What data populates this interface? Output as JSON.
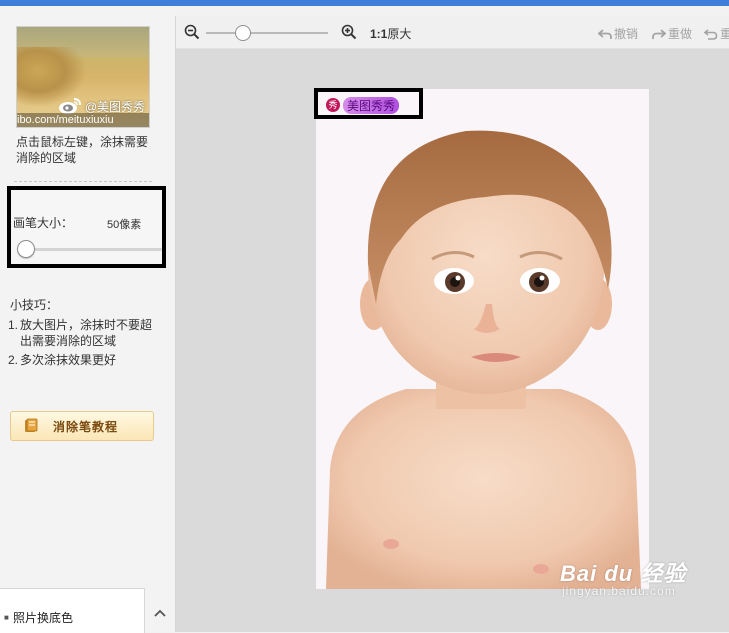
{
  "left_panel": {
    "thumbnail": {
      "watermark": "@美图秀秀",
      "url": "ibo.com/meituxiuxiu"
    },
    "hint": "点击鼠标左键，涂抹需要消除的区域",
    "brush": {
      "label": "画笔大小：",
      "value_text": "50像素"
    },
    "tips": {
      "title": "小技巧：",
      "items": [
        {
          "num": "1.",
          "text": "放大图片，涂抹时不要超出需要消除的区域"
        },
        {
          "num": "2.",
          "text": "多次涂抹效果更好"
        }
      ]
    },
    "tutorial_button": "消除笔教程",
    "bottom_tab": "照片换底色"
  },
  "toolbar": {
    "actual_size_prefix": "1:1",
    "actual_size_label": "原大",
    "undo": "撤销",
    "redo": "重做",
    "reset": "重"
  },
  "canvas": {
    "watermark_badge": "秀",
    "watermark_text": "美图秀秀"
  },
  "baidu_watermark": {
    "logo": "Bai du 经验",
    "site": "jingyan.baidu.com"
  },
  "colors": {
    "accent_bar": "#3d7fd9",
    "tutorial_text": "#7a4a10",
    "disabled_text": "#a3a3a3"
  }
}
